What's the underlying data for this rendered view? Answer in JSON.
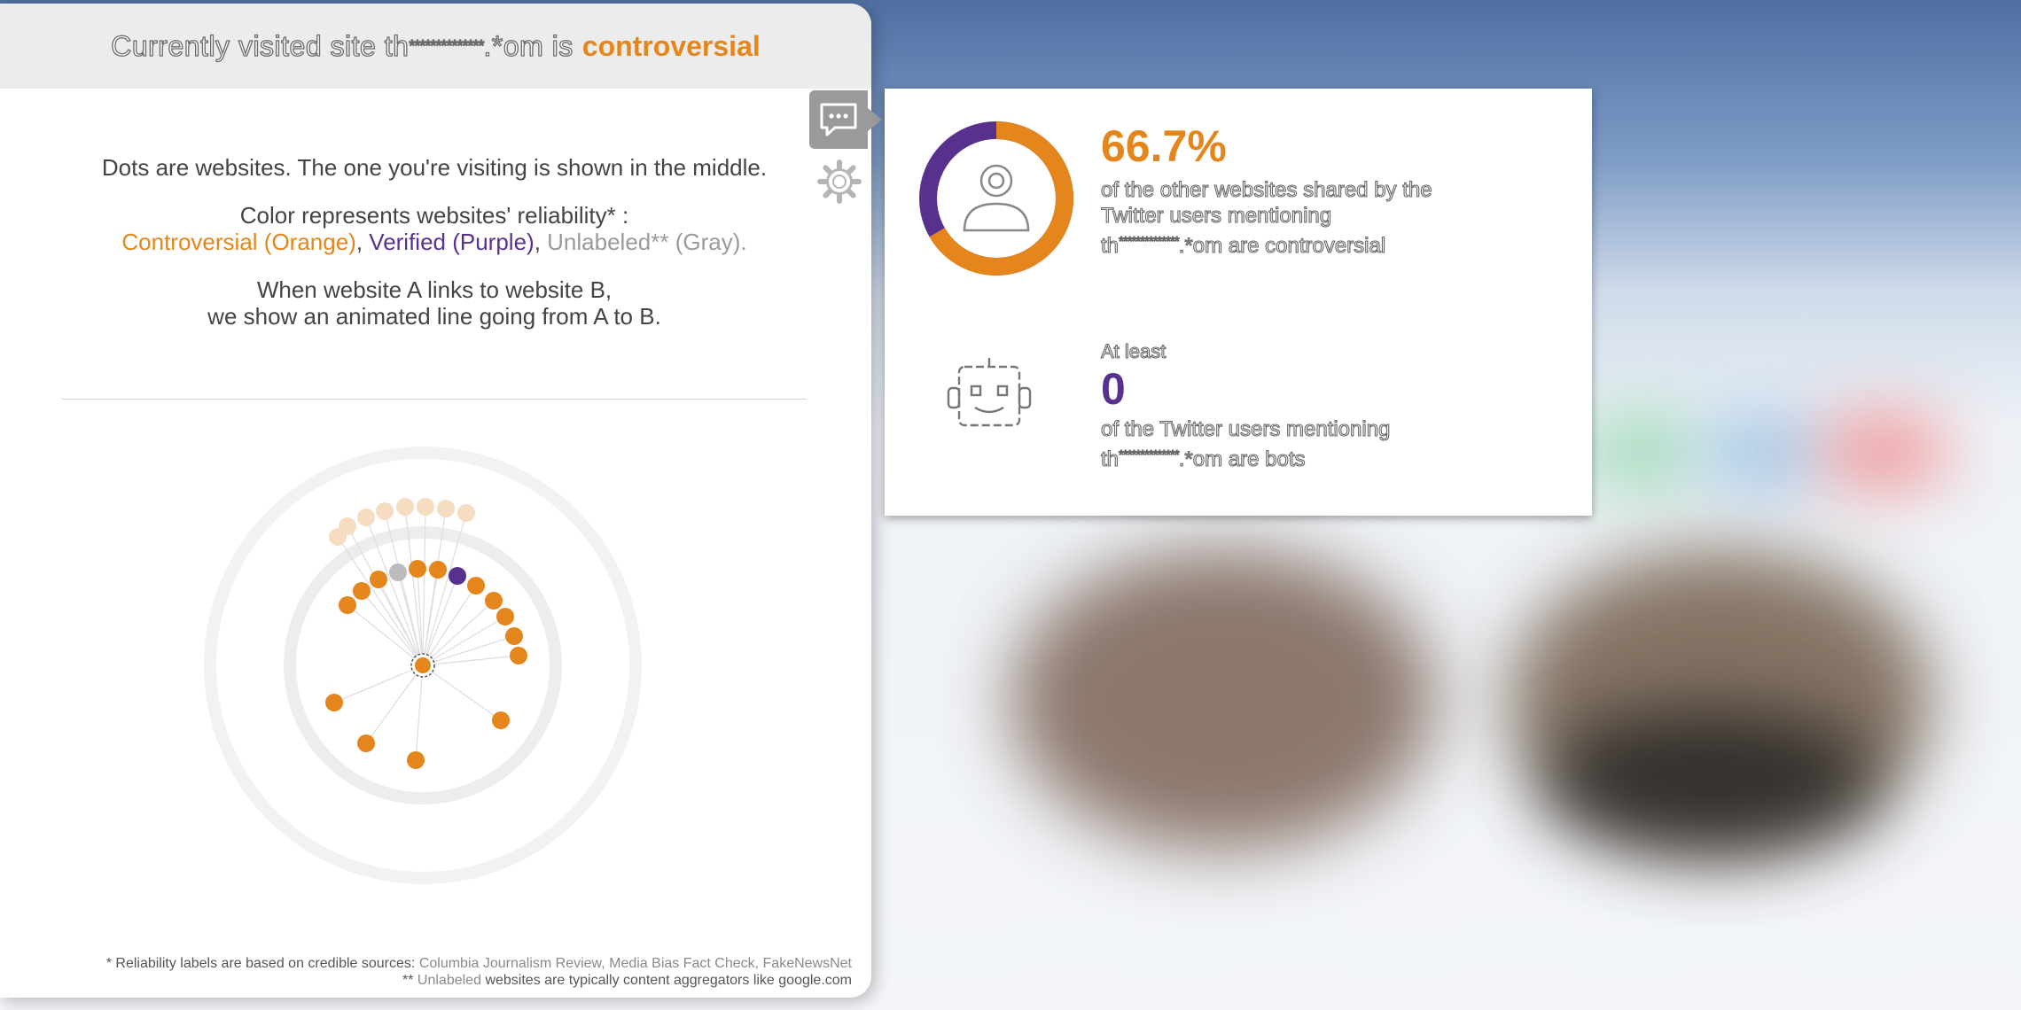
{
  "header": {
    "prefix": "Currently visited site th",
    "masked": "**************",
    "suffix": ".*om is",
    "status": "controversial"
  },
  "intro": {
    "line1": "Dots are websites. The one you're visiting is shown in the middle.",
    "line2": "Color represents websites' reliability* :",
    "legend_controversial": "Controversial (Orange)",
    "legend_verified": "Verified (Purple)",
    "legend_unlabeled": "Unlabeled** (Gray).",
    "line3": "When website A links to website B,",
    "line4": "we show an animated line going from A to B."
  },
  "footnotes": {
    "note1_prefix": "* Reliability labels are based on credible sources:",
    "sources": "Columbia Journalism Review, Media Bias Fact Check, FakeNewsNet",
    "note2_prefix": "**",
    "note2_label": "Unlabeled",
    "note2_rest": "websites are typically content aggregators like google.com"
  },
  "popup": {
    "share_percent": "66.7%",
    "share_text_line1": "of the other websites shared by the",
    "share_text_line2": "Twitter users mentioning",
    "share_text_line3_prefix": "th",
    "share_text_line3_mask": "**************",
    "share_text_line3_suffix": ".*om  are controversial",
    "bots_prefix": "At least",
    "bots_count": "0",
    "bots_text_line1": "of the Twitter users mentioning",
    "bots_text_line2_prefix": "th",
    "bots_text_line2_mask": "**************",
    "bots_text_line2_suffix": ".*om  are bots",
    "donut_controversial_fraction": 0.667
  },
  "colors": {
    "controversial": "#e4861b",
    "verified": "#58318f",
    "unlabeled": "#bbbbbb",
    "faded": "#f6dcc0"
  },
  "icons": [
    "chat-icon",
    "gear-icon",
    "user-icon",
    "robot-icon"
  ]
}
